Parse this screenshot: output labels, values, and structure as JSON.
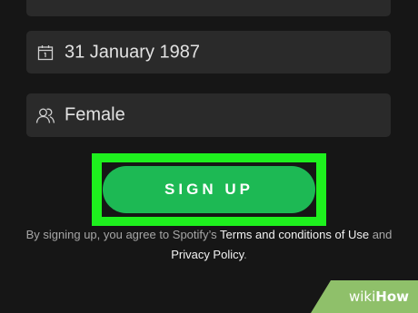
{
  "form": {
    "date_of_birth": {
      "icon": "calendar-icon",
      "value": "31 January 1987"
    },
    "gender": {
      "icon": "person-icon",
      "value": "Female"
    },
    "signup_button": {
      "label": "SIGN UP",
      "color": "#1db954",
      "highlight_color": "#1ef01e"
    },
    "terms": {
      "prefix": "By signing up, you agree to Spotify’s ",
      "terms_link": "Terms and conditions of Use",
      "middle": " and ",
      "privacy_link": "Privacy Policy",
      "suffix": "."
    }
  },
  "watermark": {
    "part1": "wiki",
    "part2": "How"
  }
}
